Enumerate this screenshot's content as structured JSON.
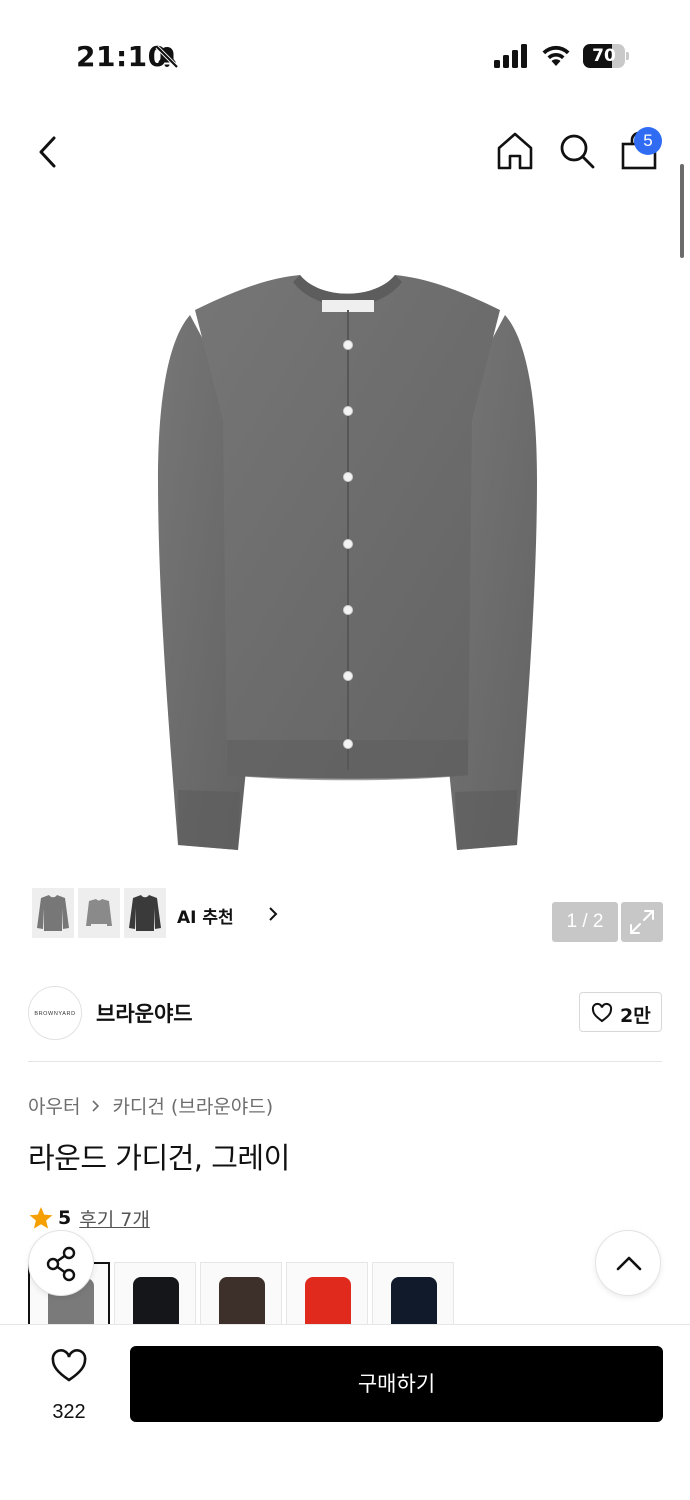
{
  "status_bar": {
    "time": "21:10",
    "battery": "70",
    "battery_level": 0.7
  },
  "nav": {
    "cart_count": "5"
  },
  "hero": {
    "image_counter": "1 / 2",
    "ai_label": "AI 추천",
    "product_color": "#6e6e6e"
  },
  "brand": {
    "logo_text": "BROWNYARD",
    "name": "브라운야드",
    "like_count": "2만"
  },
  "product": {
    "breadcrumb": [
      "아우터",
      "카디건 (브라운야드)"
    ],
    "title": "라운드 가디건, 그레이",
    "rating": "5",
    "review_link": "후기 7개",
    "swatches": [
      {
        "color": "#7a7a7a"
      },
      {
        "color": "#15161a"
      },
      {
        "color": "#3d302a"
      },
      {
        "color": "#e02a1e"
      },
      {
        "color": "#111a2a"
      }
    ]
  },
  "bottom": {
    "wish_count": "322",
    "buy_label": "구매하기"
  },
  "colors": {
    "badge": "#2f6cf3",
    "star": "#f5a000",
    "buy_button": "#000000"
  }
}
